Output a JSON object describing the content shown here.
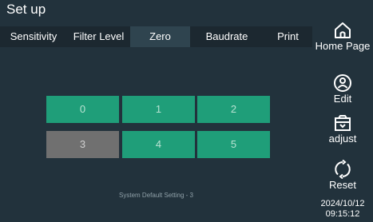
{
  "header": {
    "title": "Set up"
  },
  "tabs": [
    {
      "label": "Sensitivity"
    },
    {
      "label": "Filter Level"
    },
    {
      "label": "Zero"
    },
    {
      "label": "Baudrate"
    },
    {
      "label": "Print"
    }
  ],
  "active_tab": "Zero",
  "zero_options": [
    "0",
    "1",
    "2",
    "3",
    "4",
    "5"
  ],
  "selected_option": "3",
  "status": {
    "default_setting": "System Default Setting - 3"
  },
  "sidebar": {
    "home_label": "Home Page",
    "edit_label": "Edit",
    "adjust_label": "adjust",
    "reset_label": "Reset"
  },
  "clock": {
    "date": "2024/10/12",
    "time": "09:15:12"
  },
  "colors": {
    "background": "#22323c",
    "tab_active": "#2f444f",
    "option_normal": "#1f9e79",
    "option_selected": "#707070"
  },
  "icons": [
    "home-icon",
    "user-icon",
    "adjust-icon",
    "reset-icon"
  ]
}
